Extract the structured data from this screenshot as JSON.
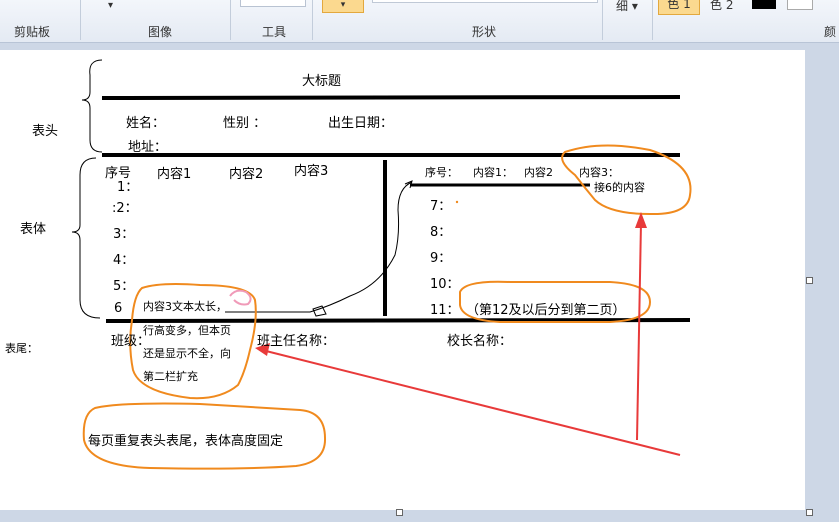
{
  "ribbon": {
    "groups": [
      "剪贴板",
      "图像",
      "工具",
      "形状",
      "颜"
    ],
    "thickness_label": "细",
    "color1_label": "色 1",
    "color2_label": "色 2"
  },
  "header": {
    "big_title": "大标题",
    "section_label": "表头",
    "name": "姓名：",
    "gender": "性别 ：",
    "birth": "出生日期：",
    "address": "地址："
  },
  "body": {
    "section_label": "表体",
    "left_cols": [
      "序号",
      "内容1",
      "内容2",
      "内容3"
    ],
    "left_rows": [
      "1：",
      ":2：",
      "3：",
      "4：",
      "5：",
      "6"
    ],
    "right_cols": [
      "序号：",
      "内容1：",
      "内容2",
      "内容3："
    ],
    "right_rows": [
      "7：",
      "8：",
      "9：",
      "10：",
      "11："
    ],
    "continue_note": "接6的内容",
    "page2_note": "（第12及以后分到第二页）",
    "overflow_note": [
      "内容3文本太长，",
      "行高变多，但本页",
      "还是显示不全，向",
      "第二栏扩充"
    ]
  },
  "footer": {
    "section_label": "表尾：",
    "class_label": "班级：",
    "teacher_label": "班主任名称：",
    "principal_label": "校长名称："
  },
  "repeat_note": "每页重复表头表尾，表体高度固定",
  "colors": {
    "annotation": "#f08a1e",
    "arrow": "#e83a3a",
    "selected": "#f9d48a"
  }
}
